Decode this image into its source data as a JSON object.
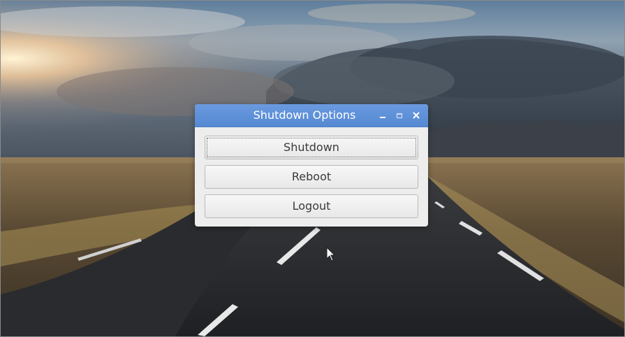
{
  "dialog": {
    "title": "Shutdown Options",
    "controls": {
      "minimize_icon": "minimize-icon",
      "maximize_icon": "maximize-icon",
      "close_icon": "close-icon"
    },
    "buttons": [
      {
        "label": "Shutdown",
        "focused": true
      },
      {
        "label": "Reboot",
        "focused": false
      },
      {
        "label": "Logout",
        "focused": false
      }
    ]
  },
  "colors": {
    "titlebar": "#5d8fd6",
    "dialog_background": "#ededed",
    "button_text": "#3a3a3a"
  }
}
